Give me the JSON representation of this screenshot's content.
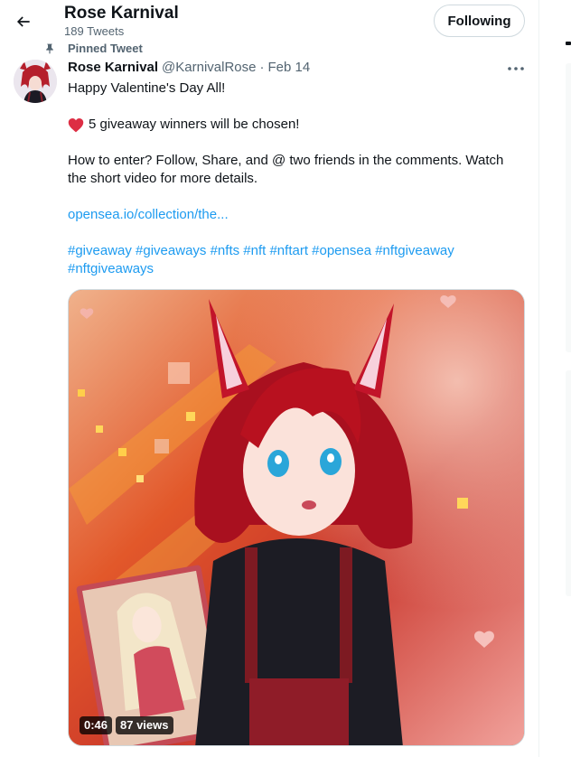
{
  "header": {
    "name": "Rose Karnival",
    "tweet_count": "189 Tweets",
    "follow_label": "Following"
  },
  "tweet": {
    "pinned_label": "Pinned Tweet",
    "author_name": "Rose Karnival",
    "handle": "@KarnivalRose",
    "separator": "·",
    "date": "Feb 14",
    "line1": "Happy Valentine's Day All!",
    "line2": "5 giveaway winners will be chosen!",
    "line3": "How to enter? Follow, Share, and @ two friends in the comments. Watch",
    "line4": "the short video for more details.",
    "link": "opensea.io/collection/the...",
    "hashtags1": "#giveaway #giveaways #nfts #nft #nftart #opensea #nftgiveaway",
    "hashtags2": "#nftgiveaways",
    "video": {
      "duration": "0:46",
      "views": "87 views"
    }
  },
  "icons": {
    "back": "arrow-left-icon",
    "pin": "pin-icon",
    "more": "more-icon",
    "heart": "red-heart-emoji"
  },
  "colors": {
    "link": "#1d9bf0",
    "secondary_text": "#536471",
    "heart": "#f91880"
  }
}
